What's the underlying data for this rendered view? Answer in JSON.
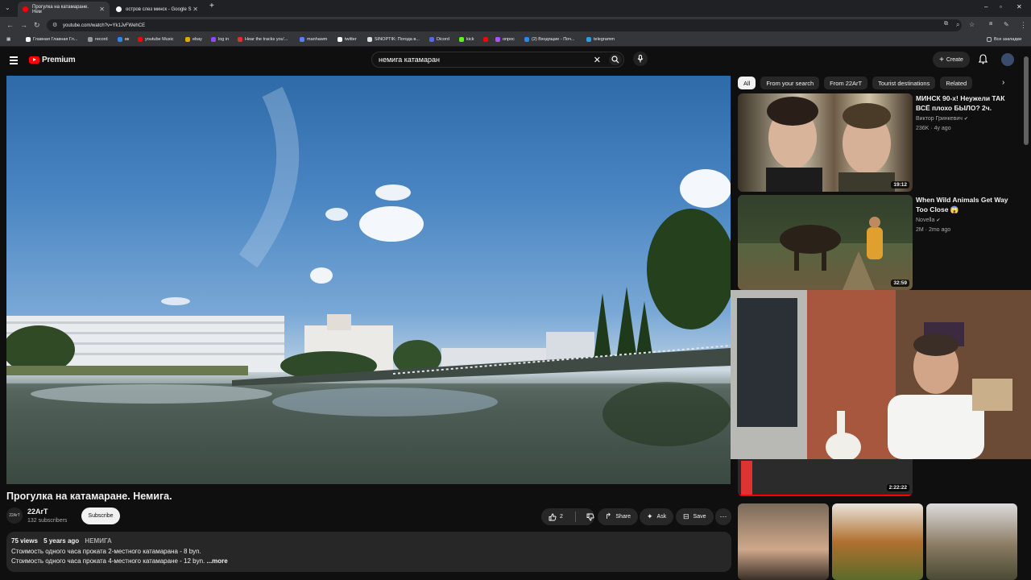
{
  "browser": {
    "tabs": [
      {
        "title": "Прогулка на катамаране. Нем",
        "active": true
      },
      {
        "title": "остров слез минск - Google S",
        "active": false
      }
    ],
    "url": "youtube.com/watch?v=Yk1JvFWehCE",
    "bookmarks": [
      "Главная Главная Гл...",
      "record",
      "вк",
      "youtube Music",
      "ebay",
      "log in",
      "Hear the tracks you'...",
      "manhawm",
      "twitter",
      "SINOPTIK: Погода в...",
      "Dicord",
      "kick",
      "опрос",
      "(2) Входящие - Поч...",
      "telegramm"
    ],
    "bookmarks_all": "Все закладки"
  },
  "header": {
    "brand": "Premium",
    "search_query": "немига катамаран",
    "create_label": "Create"
  },
  "video": {
    "title": "Прогулка на катамаране. Немига.",
    "channel": "22ArT",
    "subscribers": "132 subscribers",
    "subscribe_label": "Subscribe",
    "likes": "2",
    "share_label": "Share",
    "ask_label": "Ask",
    "save_label": "Save",
    "views": "75 views",
    "age": "5 years ago",
    "tag": "НЕМИГА",
    "desc_line1": "Стоимость одного часа проката  2-местного катамарана - 8 byn.",
    "desc_line2": "Стоимость одного часа проката 4-местного катамаране - 12 byn.",
    "more_label": "...more"
  },
  "chips": [
    "All",
    "From your search",
    "From 22ArT",
    "Tourist destinations",
    "Related"
  ],
  "recommendations": [
    {
      "title": "МИНСК 90-х! Неужели ТАК ВСЁ плохо БЫЛО? 2ч.",
      "channel": "Виктор Гринкевич",
      "meta": "236K · 4y ago",
      "duration": "19:12"
    },
    {
      "title": "When Wild Animals Get Way Too Close 😱",
      "channel": "Novella",
      "meta": "2M · 2mo ago",
      "duration": "32:59"
    },
    {
      "title": "",
      "channel": "",
      "meta": "",
      "duration": "2:22:22"
    }
  ],
  "colors": {
    "accent": "#ff0000",
    "bg": "#0f0f0f",
    "surface": "#272727"
  }
}
